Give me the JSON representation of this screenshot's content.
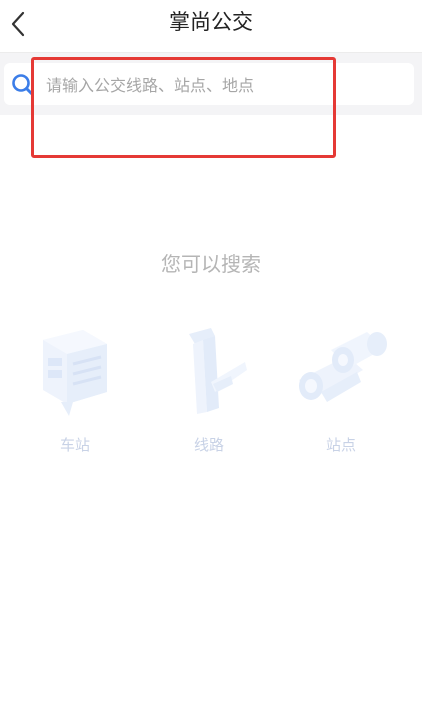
{
  "nav": {
    "title": "掌尚公交",
    "back_icon": "chevron-left-icon"
  },
  "search": {
    "placeholder": "请输入公交线路、站点、地点",
    "value": "",
    "icon": "search-icon"
  },
  "empty_state": {
    "hint": "您可以搜索",
    "categories": [
      {
        "label": "车站",
        "icon": "station-icon"
      },
      {
        "label": "线路",
        "icon": "route-icon"
      },
      {
        "label": "站点",
        "icon": "stop-icon"
      }
    ]
  },
  "colors": {
    "highlight": "#e53935",
    "search_icon": "#3b7de8",
    "category_label": "#c8d2e6",
    "hint_text": "#b5b5b5"
  }
}
